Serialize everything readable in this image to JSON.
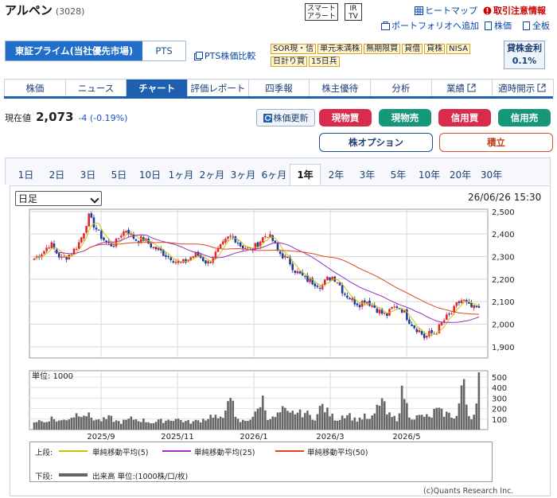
{
  "header": {
    "title": "アルペン",
    "code": "(3028)",
    "smart_alert": "スマート\nアラート",
    "ir_tv": "IR\nTV",
    "heatmap": "ヒートマップ",
    "restrict": "取引注意情報",
    "portfolio": "ポートフォリオへ追加",
    "stock_price": "株価",
    "board": "全板"
  },
  "market": {
    "primary": "東証プライム(当社優先市場)",
    "pts": "PTS",
    "pts_compare": "PTS株価比較"
  },
  "tags": [
    "SOR現・信",
    "単元未満株",
    "無期限買",
    "貸借",
    "貸株",
    "NISA",
    "日計り買",
    "15日兵"
  ],
  "lending": {
    "label": "貸株金利",
    "rate": "0.1%"
  },
  "tabs": [
    "株価",
    "ニュース",
    "チャート",
    "評価レポート",
    "四季報",
    "株主優待",
    "分析",
    "業績",
    "適時開示"
  ],
  "quote": {
    "label": "現在値",
    "value": "2,073",
    "change": "-4 (-0.19%)"
  },
  "buttons": {
    "update": "株価更新",
    "cash_buy": "現物買",
    "cash_sell": "現物売",
    "margin_buy": "信用買",
    "margin_sell": "信用売",
    "option": "株オプション",
    "accumulate": "積立"
  },
  "colors": {
    "cash_buy": "#d92b4b",
    "cash_sell": "#17977a",
    "margin_buy": "#d92b4b",
    "margin_sell": "#17977a",
    "tab_active": "#1f5fb0"
  },
  "periods": [
    "1日",
    "2日",
    "3日",
    "5日",
    "10日",
    "1ヶ月",
    "2ヶ月",
    "3ヶ月",
    "6ヶ月",
    "1年",
    "2年",
    "3年",
    "5年",
    "10年",
    "20年",
    "30年"
  ],
  "active_period": "1年",
  "chart_select": "日足",
  "datetime": "26/06/26 15:30",
  "legend": {
    "upper": "上段:",
    "ma5": "単純移動平均(5)",
    "ma25": "単純移動平均(25)",
    "ma50": "単純移動平均(50)",
    "lower": "下段:",
    "volume": "出来高 単位:(1000株/口/枚)"
  },
  "copyright": "(c)Quants Research Inc.",
  "chart_data": {
    "type": "candlestick",
    "price_ticks": [
      2500,
      2400,
      2300,
      2200,
      2100,
      2000,
      1900
    ],
    "ylim": [
      1850,
      2510
    ],
    "x_labels": [
      "2025/9",
      "2025/11",
      "2026/1",
      "2026/3",
      "2026/5"
    ],
    "volume_unit": "単位: 1000",
    "volume_ticks": [
      500,
      400,
      300,
      200,
      100
    ],
    "volume_ylim": [
      0,
      560
    ],
    "series": [
      {
        "name": "単純移動平均(5)",
        "color": "#c9c400"
      },
      {
        "name": "単純移動平均(25)",
        "color": "#9b2fbf"
      },
      {
        "name": "単純移動平均(50)",
        "color": "#e0471a"
      }
    ],
    "close_path": [
      2290,
      2310,
      2330,
      2360,
      2320,
      2290,
      2300,
      2320,
      2350,
      2400,
      2480,
      2440,
      2400,
      2370,
      2350,
      2360,
      2400,
      2420,
      2390,
      2370,
      2380,
      2360,
      2340,
      2330,
      2310,
      2300,
      2280,
      2270,
      2280,
      2300,
      2310,
      2290,
      2270,
      2300,
      2330,
      2360,
      2390,
      2380,
      2350,
      2340,
      2330,
      2350,
      2380,
      2400,
      2370,
      2320,
      2300,
      2280,
      2240,
      2220,
      2200,
      2190,
      2180,
      2170,
      2200,
      2210,
      2190,
      2140,
      2120,
      2100,
      2090,
      2110,
      2090,
      2070,
      2050,
      2040,
      2070,
      2080,
      2060,
      2020,
      1990,
      1970,
      1940,
      1960,
      1960,
      2000,
      2030,
      2050,
      2090,
      2110,
      2080,
      2070,
      2073
    ],
    "volume_path": [
      80,
      90,
      70,
      120,
      95,
      85,
      110,
      130,
      160,
      170,
      140,
      110,
      90,
      100,
      120,
      85,
      75,
      90,
      110,
      100,
      95,
      80,
      70,
      85,
      90,
      100,
      110,
      95,
      80,
      75,
      85,
      100,
      120,
      150,
      110,
      95,
      470,
      110,
      80,
      90,
      120,
      160,
      330,
      130,
      110,
      150,
      200,
      140,
      180,
      160,
      170,
      130,
      120,
      250,
      180,
      130,
      100,
      150,
      160,
      100,
      110,
      130,
      90,
      180,
      320,
      160,
      120,
      110,
      420,
      160,
      120,
      130,
      140,
      110,
      200,
      170,
      160,
      140,
      130,
      510,
      150,
      120,
      550
    ]
  }
}
